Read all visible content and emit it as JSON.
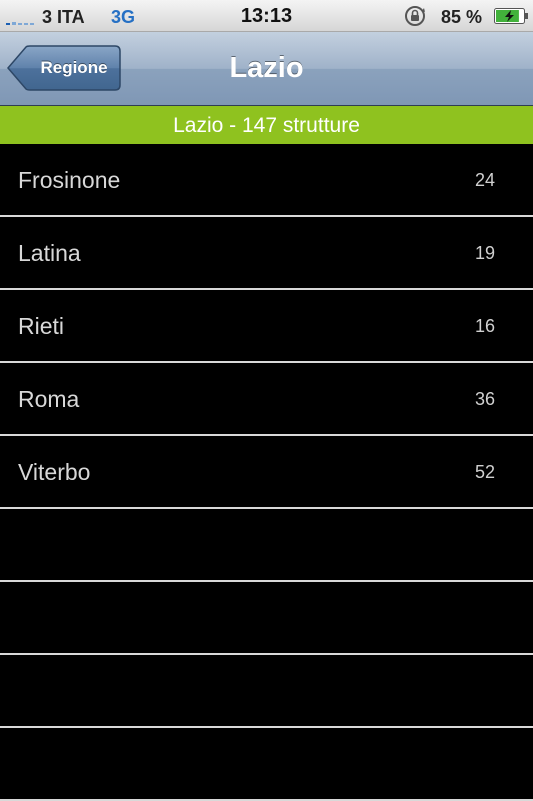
{
  "status_bar": {
    "carrier": "3 ITA",
    "network": "3G",
    "time": "13:13",
    "battery_percent": "85 %",
    "battery_level": 0.85,
    "icons": [
      "signal-icon",
      "rotation-lock-icon",
      "battery-charging-icon"
    ]
  },
  "nav": {
    "back_label": "Regione",
    "title": "Lazio"
  },
  "section": {
    "header": "Lazio - 147 strutture",
    "color": "#8fc21f"
  },
  "list": {
    "items": [
      {
        "name": "Frosinone",
        "count": "24"
      },
      {
        "name": "Latina",
        "count": "19"
      },
      {
        "name": "Rieti",
        "count": "16"
      },
      {
        "name": "Roma",
        "count": "36"
      },
      {
        "name": "Viterbo",
        "count": "52"
      },
      {
        "name": "",
        "count": ""
      },
      {
        "name": "",
        "count": ""
      },
      {
        "name": "",
        "count": ""
      },
      {
        "name": "",
        "count": ""
      }
    ]
  }
}
